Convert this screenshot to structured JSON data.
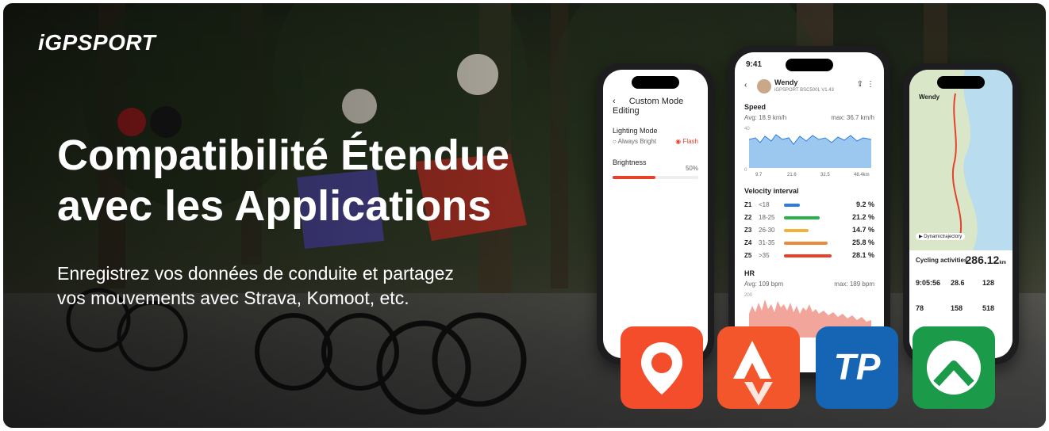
{
  "brand": {
    "logo": "iGPSPORT"
  },
  "hero": {
    "headline_line1": "Compatibilité Étendue",
    "headline_line2": "avec les Applications",
    "subtitle_line1": "Enregistrez vos données de conduite et partagez",
    "subtitle_line2": "vos mouvements avec Strava, Komoot, etc."
  },
  "phone_left": {
    "title": "Custom Mode Editing",
    "lighting_mode_label": "Lighting Mode",
    "option_always_bright": "Always Bright",
    "option_flash": "Flash",
    "brightness_label": "Brightness",
    "brightness_value": "50%",
    "brightness_fraction": 0.5
  },
  "phone_mid": {
    "time": "9:41",
    "user_name": "Wendy",
    "device": "iGPSPORT BSC500L V1.43",
    "speed_label": "Speed",
    "speed_avg": "Avg: 18.9 km/h",
    "speed_max": "max: 36.7 km/h",
    "speed_axis": [
      "9.7",
      "21.6",
      "32.5",
      "48.4km"
    ],
    "speed_y_top": "40",
    "speed_y_bottom": "0",
    "velocity_label": "Velocity interval",
    "zones": [
      {
        "zone": "Z1",
        "range": "<18",
        "percent": "9.2 %",
        "value": 9.2,
        "color": "#2d7be5"
      },
      {
        "zone": "Z2",
        "range": "18-25",
        "percent": "21.2 %",
        "value": 21.2,
        "color": "#2bb24c"
      },
      {
        "zone": "Z3",
        "range": "26-30",
        "percent": "14.7 %",
        "value": 14.7,
        "color": "#f0b23a"
      },
      {
        "zone": "Z4",
        "range": "31-35",
        "percent": "25.8 %",
        "value": 25.8,
        "color": "#f08a3a"
      },
      {
        "zone": "Z5",
        "range": ">35",
        "percent": "28.1 %",
        "value": 28.1,
        "color": "#e5412d"
      }
    ],
    "hr_label": "HR",
    "hr_avg": "Avg: 109 bpm",
    "hr_max": "max: 189 bpm",
    "hr_y_top": "200"
  },
  "phone_right": {
    "user_name": "Wendy",
    "dynamic_label": "Dynamictrajectory",
    "activity_label": "Cycling activities",
    "distance": "286.12",
    "distance_unit": "km",
    "duration": "9:05:56",
    "avg_speed": "28.6",
    "max_hr": "128",
    "avg_cadence": "78",
    "avg_power": "158",
    "max_power": "518"
  },
  "apps": [
    {
      "name": "map-pin-app-icon",
      "color": "#f44d2b"
    },
    {
      "name": "strava-app-icon",
      "color": "#f4562b"
    },
    {
      "name": "trainingpeaks-app-icon",
      "label": "TP",
      "color": "#1565b4"
    },
    {
      "name": "komoot-app-icon",
      "color": "#1b9a4a"
    }
  ]
}
